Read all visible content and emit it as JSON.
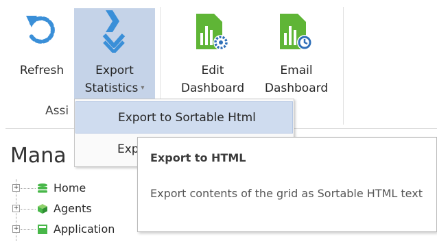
{
  "ribbon": {
    "refresh": {
      "label": "Refresh"
    },
    "export_statistics": {
      "line1": "Export",
      "line2": "Statistics",
      "caret": "▾"
    },
    "edit_dashboard": {
      "line1": "Edit",
      "line2": "Dashboard"
    },
    "email_dashboard": {
      "line1": "Email",
      "line2": "Dashboard"
    },
    "group_label": "Assi"
  },
  "menu": {
    "items": [
      {
        "label": "Export to Sortable Html",
        "highlighted": true
      },
      {
        "label": "Exp",
        "highlighted": false
      }
    ]
  },
  "tooltip": {
    "title": "Export to HTML",
    "body": "Export contents of the grid as Sortable HTML text"
  },
  "manage": {
    "title": "Mana"
  },
  "tree": {
    "items": [
      {
        "label": "Home",
        "icon": "database-icon"
      },
      {
        "label": "Agents",
        "icon": "agents-cube-icon"
      },
      {
        "label": "Application",
        "icon": "application-icon"
      }
    ]
  },
  "colors": {
    "accent_blue": "#3a8fd8",
    "export_bg": "#c5d3e8",
    "menu_highlight": "#cfdcef",
    "dashboard_green": "#5fb536",
    "tree_green": "#48b749"
  }
}
